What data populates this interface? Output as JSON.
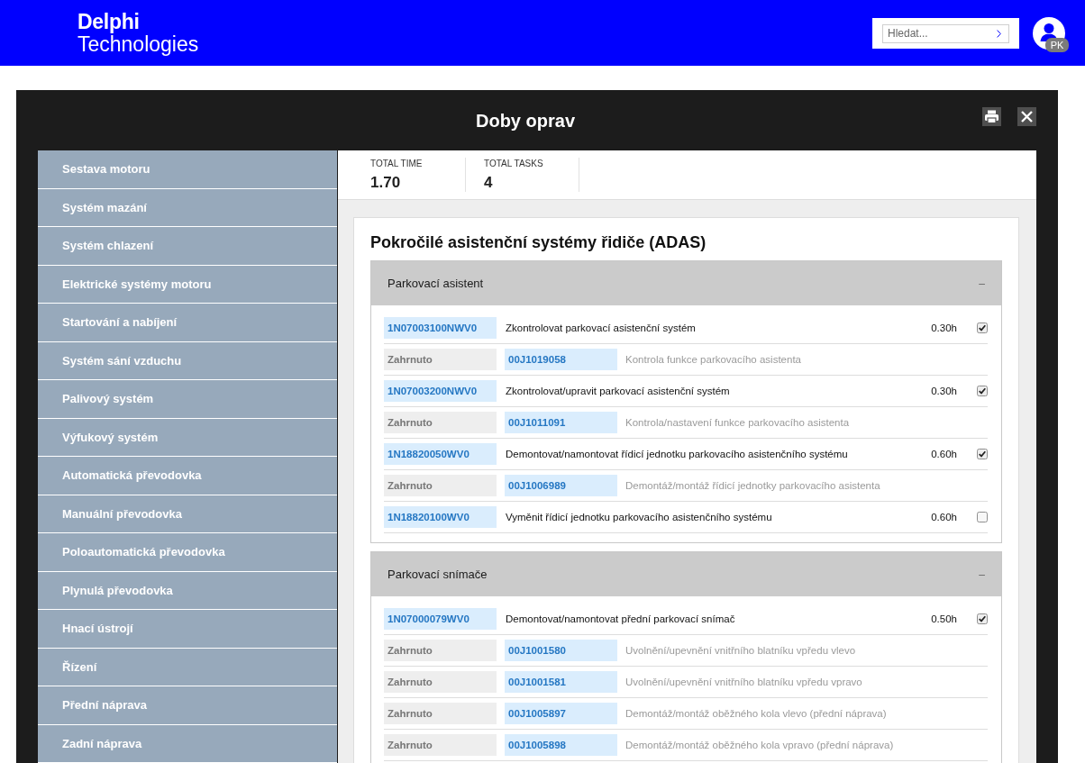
{
  "header": {
    "logo": {
      "line_1": "Delphi",
      "line_2": "Technologies"
    },
    "search": {
      "placeholder": "Hledat..."
    },
    "user": {
      "initials": "PK"
    }
  },
  "dialog": {
    "title": "Doby oprav"
  },
  "sidebar": {
    "items": [
      {
        "label": "Sestava motoru"
      },
      {
        "label": "Systém mazání"
      },
      {
        "label": "Systém chlazení"
      },
      {
        "label": "Elektrické systémy motoru"
      },
      {
        "label": "Startování a nabíjení"
      },
      {
        "label": "Systém sání vzduchu"
      },
      {
        "label": "Palivový systém"
      },
      {
        "label": "Výfukový systém"
      },
      {
        "label": "Automatická převodovka"
      },
      {
        "label": "Manuální převodovka"
      },
      {
        "label": "Poloautomatická převodovka"
      },
      {
        "label": "Plynulá převodovka"
      },
      {
        "label": "Hnací ústrojí"
      },
      {
        "label": "Řízení"
      },
      {
        "label": "Přední náprava"
      },
      {
        "label": "Zadní náprava"
      }
    ]
  },
  "summary": [
    {
      "label": "TOTAL TIME",
      "value": "1.70"
    },
    {
      "label": "TOTAL TASKS",
      "value": "4"
    }
  ],
  "content": {
    "title": "Pokročilé asistenční systémy řidiče (ADAS)",
    "sections": [
      {
        "title": "Parkovací asistent",
        "toggle": "–",
        "rows": [
          {
            "kind": "task",
            "code": "1N07003100NWV0",
            "description": "Zkontrolovat parkovací asistenční systém",
            "time": "0.30h",
            "checked": true
          },
          {
            "kind": "included",
            "status": "Zahrnuto",
            "code": "00J1019058",
            "description": "Kontrola funkce parkovacího asistenta"
          },
          {
            "kind": "task",
            "code": "1N07003200NWV0",
            "description": "Zkontrolovat/upravit parkovací asistenční systém",
            "time": "0.30h",
            "checked": true
          },
          {
            "kind": "included",
            "status": "Zahrnuto",
            "code": "00J1011091",
            "description": "Kontrola/nastavení funkce parkovacího asistenta"
          },
          {
            "kind": "task",
            "code": "1N18820050WV0",
            "description": "Demontovat/namontovat řídicí jednotku parkovacího asistenčního systému",
            "time": "0.60h",
            "checked": true
          },
          {
            "kind": "included",
            "status": "Zahrnuto",
            "code": "00J1006989",
            "description": "Demontáž/montáž řídicí jednotky parkovacího asistenta"
          },
          {
            "kind": "task",
            "code": "1N18820100WV0",
            "description": "Vyměnit řídicí jednotku parkovacího asistenčního systému",
            "time": "0.60h",
            "checked": false
          }
        ]
      },
      {
        "title": "Parkovací snímače",
        "toggle": "–",
        "rows": [
          {
            "kind": "task",
            "code": "1N07000079WV0",
            "description": "Demontovat/namontovat přední parkovací snímač",
            "time": "0.50h",
            "checked": true
          },
          {
            "kind": "included",
            "status": "Zahrnuto",
            "code": "00J1001580",
            "description": "Uvolnění/upevnění vnitřního blatníku vpředu vlevo"
          },
          {
            "kind": "included",
            "status": "Zahrnuto",
            "code": "00J1001581",
            "description": "Uvolnění/upevnění vnitřního blatníku vpředu vpravo"
          },
          {
            "kind": "included",
            "status": "Zahrnuto",
            "code": "00J1005897",
            "description": "Demontáž/montáž oběžného kola vlevo (přední náprava)"
          },
          {
            "kind": "included",
            "status": "Zahrnuto",
            "code": "00J1005898",
            "description": "Demontáž/montáž oběžného kola vpravo (přední náprava)"
          }
        ]
      }
    ]
  }
}
